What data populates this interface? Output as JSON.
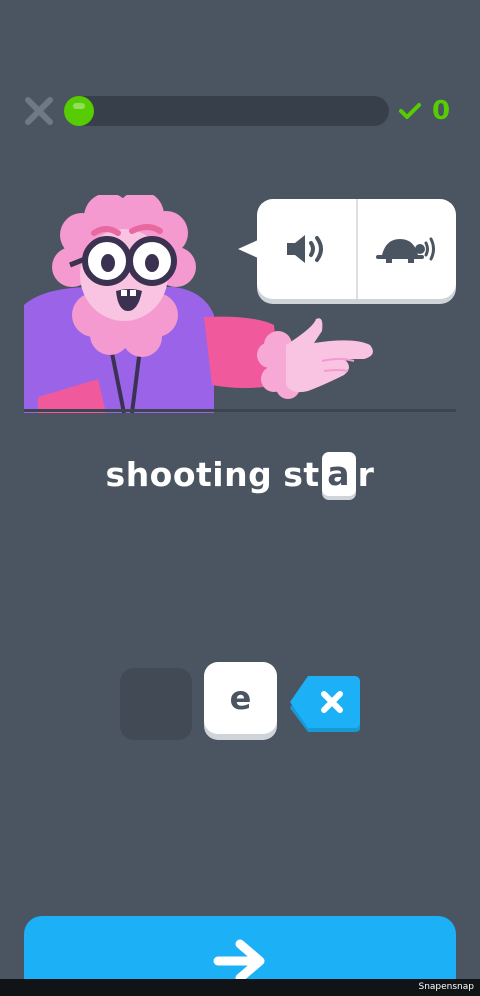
{
  "top_bar": {
    "close_icon": "close-x-icon",
    "progress": 0.08,
    "streak_icon": "checkmark-icon",
    "streak_count": "0"
  },
  "audio": {
    "normal_icon": "speaker-icon",
    "slow_icon": "turtle-speaker-icon"
  },
  "word": {
    "prefix": "shooting",
    "part2_before": "st",
    "blank_letter": "a",
    "part2_after": "r"
  },
  "tiles": {
    "letter": "e",
    "backspace_icon": "backspace-x-icon"
  },
  "continue": {
    "icon": "arrow-right-icon"
  },
  "footer": {
    "watermark": "Snapensnap"
  },
  "colors": {
    "background": "#4b5561",
    "green": "#58cc02",
    "blue": "#1cb0f6",
    "white": "#ffffff",
    "purple": "#9b63e8",
    "pink": "#f49ad1"
  }
}
